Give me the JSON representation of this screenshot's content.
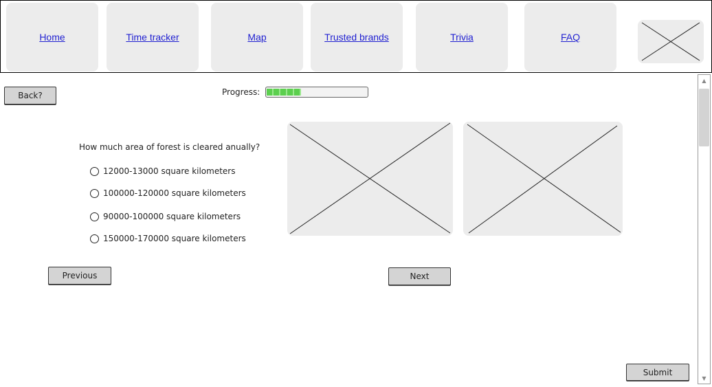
{
  "nav": {
    "items": [
      {
        "label": "Home"
      },
      {
        "label": "Time tracker"
      },
      {
        "label": "Map"
      },
      {
        "label": "Trusted brands"
      },
      {
        "label": "Trivia"
      },
      {
        "label": "FAQ"
      }
    ],
    "logo_icon": "image-placeholder-icon"
  },
  "back_button": {
    "label": "Back?"
  },
  "progress": {
    "label": "Progress:",
    "value": 0.34,
    "color": "#5ccf4f"
  },
  "quiz": {
    "question": "How much area of forest is cleared anually?",
    "options": [
      {
        "label": "12000-13000 square kilometers",
        "selected": false
      },
      {
        "label": "100000-120000 square kilometers",
        "selected": false
      },
      {
        "label": "90000-100000 square kilometers",
        "selected": false
      },
      {
        "label": "150000-170000 square kilometers",
        "selected": false
      }
    ]
  },
  "images": [
    {
      "icon": "image-placeholder-icon"
    },
    {
      "icon": "image-placeholder-icon"
    }
  ],
  "buttons": {
    "previous": "Previous",
    "next": "Next",
    "submit": "Submit"
  },
  "scrollbar": {
    "up_icon": "▲",
    "down_icon": "▼"
  },
  "colors": {
    "link": "#1f1fd1",
    "placeholder": "#ececec",
    "button": "#d4d4d4"
  }
}
